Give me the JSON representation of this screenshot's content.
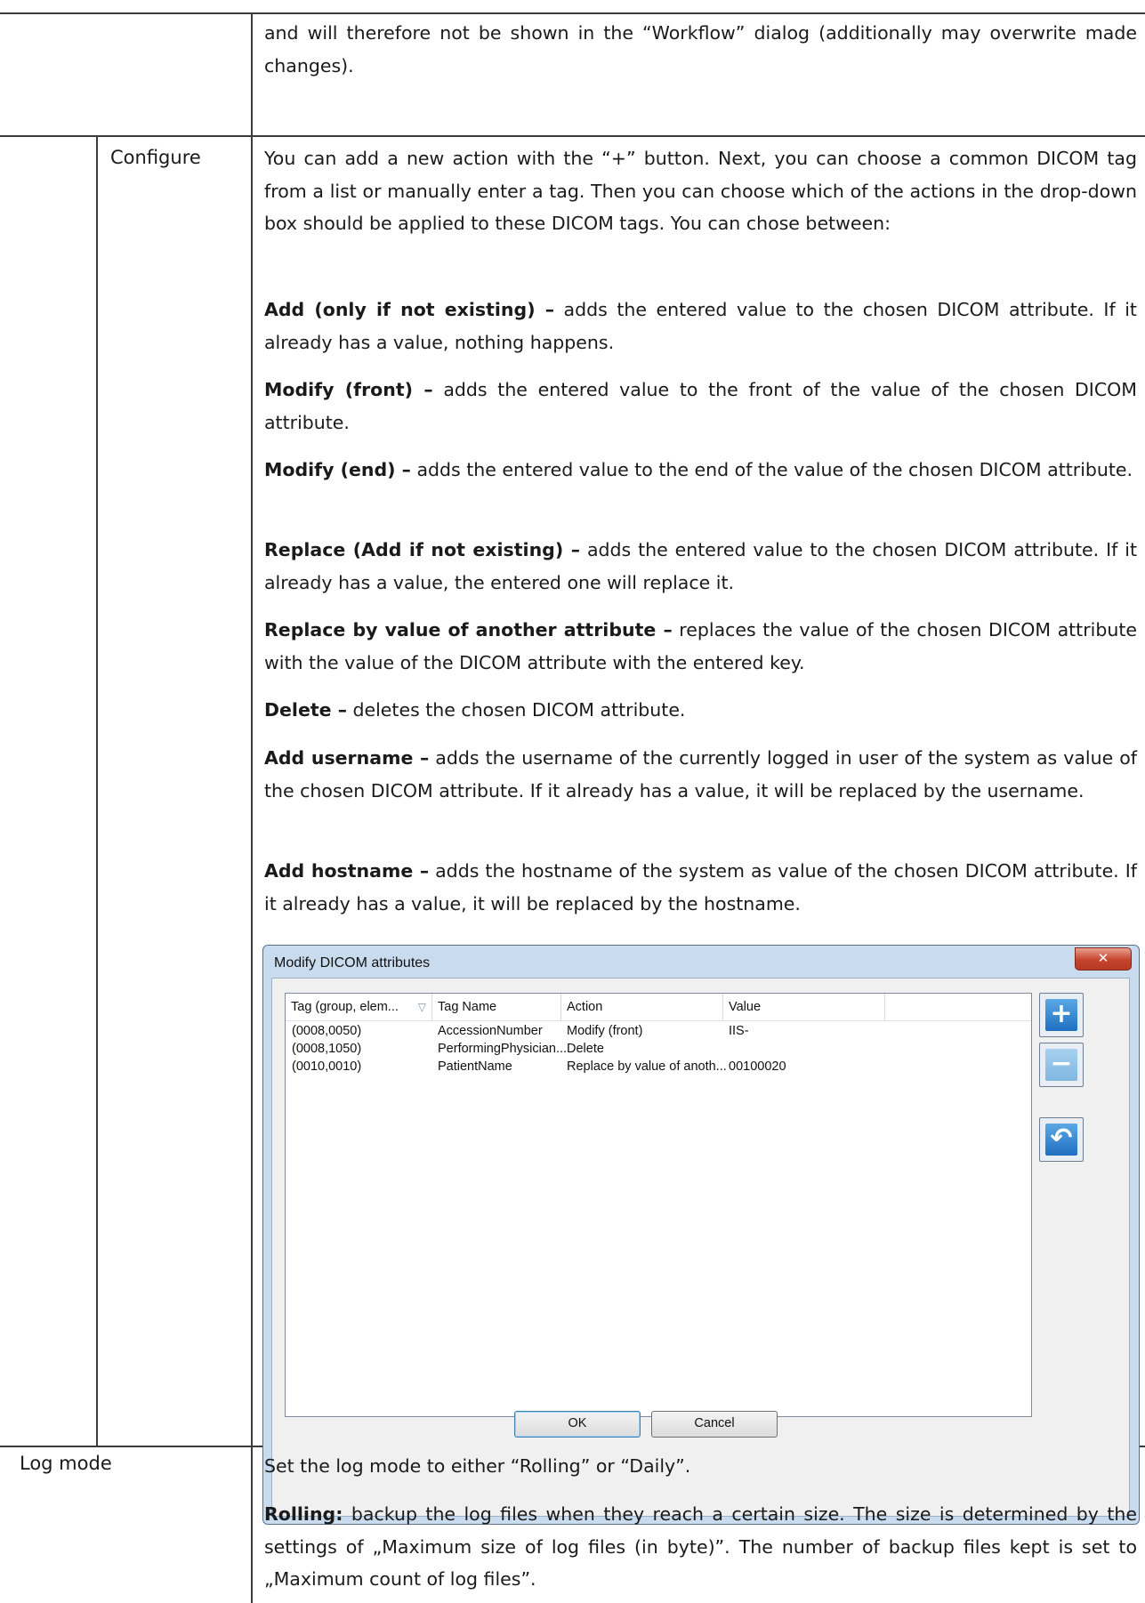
{
  "row_top": {
    "paragraph": "and will therefore not be shown in the “Workflow” dialog (additionally may overwrite made changes)."
  },
  "configure": {
    "label": "Configure",
    "intro": "You can add a new action with the “+” button. Next, you can choose a common DICOM tag from a list or manually enter a tag. Then you can choose which of the actions in the drop-down box should be applied to these DICOM tags. You can chose between:",
    "items": [
      {
        "term": "Add (only if not existing) –",
        "desc": "adds the entered value to the chosen DICOM attribute. If it already has a value, nothing happens."
      },
      {
        "term": "Modify (front) –",
        "desc": "adds the entered value to the front of the value of the chosen DICOM attribute."
      },
      {
        "term": "Modify (end) –",
        "desc": "adds the entered value to the end of the value of the chosen DICOM attribute."
      },
      {
        "term": "Replace (Add if not existing) –",
        "desc": "adds the entered value to the chosen DICOM attribute. If it already has a value, the entered one will replace it."
      },
      {
        "term": "Replace by value of another attribute –",
        "desc": "replaces the value of the chosen DICOM attribute with the value of the DICOM attribute with the entered key."
      },
      {
        "term": "Delete –",
        "desc": "deletes the chosen DICOM attribute."
      },
      {
        "term": "Add username –",
        "desc": "adds the username of the currently logged in user of the system as value of the chosen DICOM attribute. If it already has a value, it will be replaced by the username."
      },
      {
        "term": "Add hostname –",
        "desc": "adds the hostname of the system as value of the chosen DICOM attribute. If it already has a value, it will be replaced by the hostname."
      }
    ]
  },
  "dialog": {
    "title": "Modify DICOM attributes",
    "close_icon": "close-icon",
    "columns": [
      "Tag (group, elem...",
      "Tag Name",
      "Action",
      "Value"
    ],
    "rows": [
      {
        "tag": "(0008,0050)",
        "name": "AccessionNumber",
        "action": "Modify (front)",
        "value": "IIS-"
      },
      {
        "tag": "(0008,1050)",
        "name": "PerformingPhysician...",
        "action": "Delete",
        "value": ""
      },
      {
        "tag": "(0010,0010)",
        "name": "PatientName",
        "action": "Replace by value of anoth...",
        "value": "00100020"
      }
    ],
    "add_button": "+",
    "remove_button": "−",
    "reset_button": "↶",
    "ok_label": "OK",
    "cancel_label": "Cancel"
  },
  "logmode": {
    "label": "Log mode",
    "paragraph1": "Set the log mode to either “Rolling” or “Daily”.",
    "rolling_term": "Rolling:",
    "rolling_desc": "backup the log files when they reach a certain size. The size is determined by the settings of „Maximum size of log files (in byte)”. The number of backup files kept is set to „Maximum count of log files”."
  }
}
